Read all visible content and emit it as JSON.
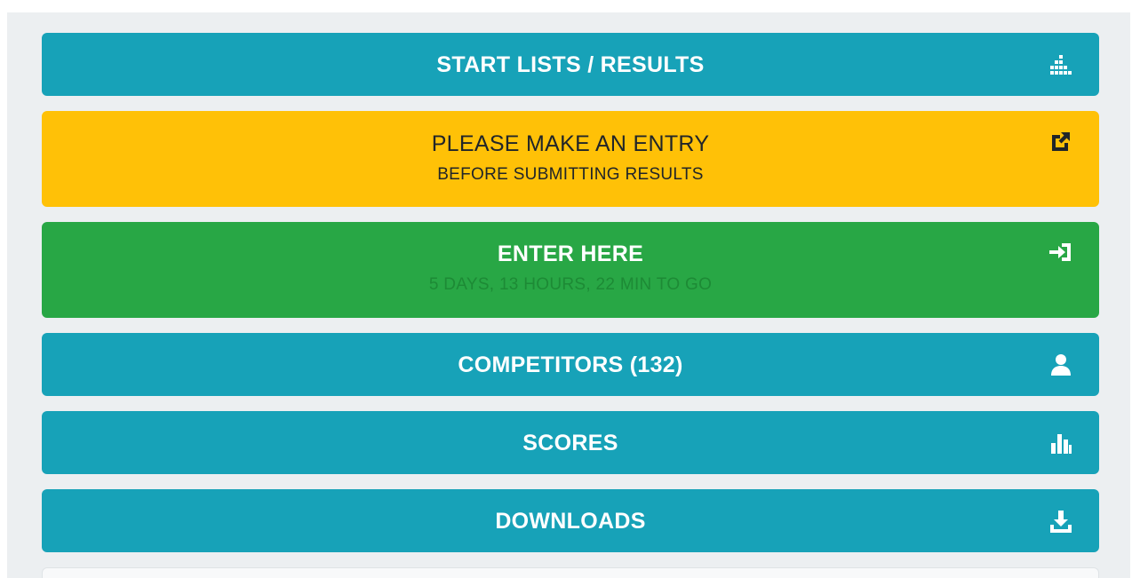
{
  "buttons": {
    "start_lists": {
      "label": "START LISTS / RESULTS",
      "icon": "sort-amount-icon"
    },
    "make_entry": {
      "label": "PLEASE MAKE AN ENTRY",
      "sub": "BEFORE SUBMITTING RESULTS",
      "icon": "external-link-icon"
    },
    "enter_here": {
      "label": "ENTER HERE",
      "sub": "5 DAYS, 13 HOURS, 22 MIN TO GO",
      "icon": "sign-in-icon"
    },
    "competitors": {
      "label": "COMPETITORS (132)",
      "icon": "user-icon"
    },
    "scores": {
      "label": "SCORES",
      "icon": "bar-chart-icon"
    },
    "downloads": {
      "label": "DOWNLOADS",
      "icon": "download-icon"
    }
  },
  "colors": {
    "teal": "#17a2b8",
    "yellow": "#ffc107",
    "green": "#28a745",
    "background": "#eceff1"
  }
}
